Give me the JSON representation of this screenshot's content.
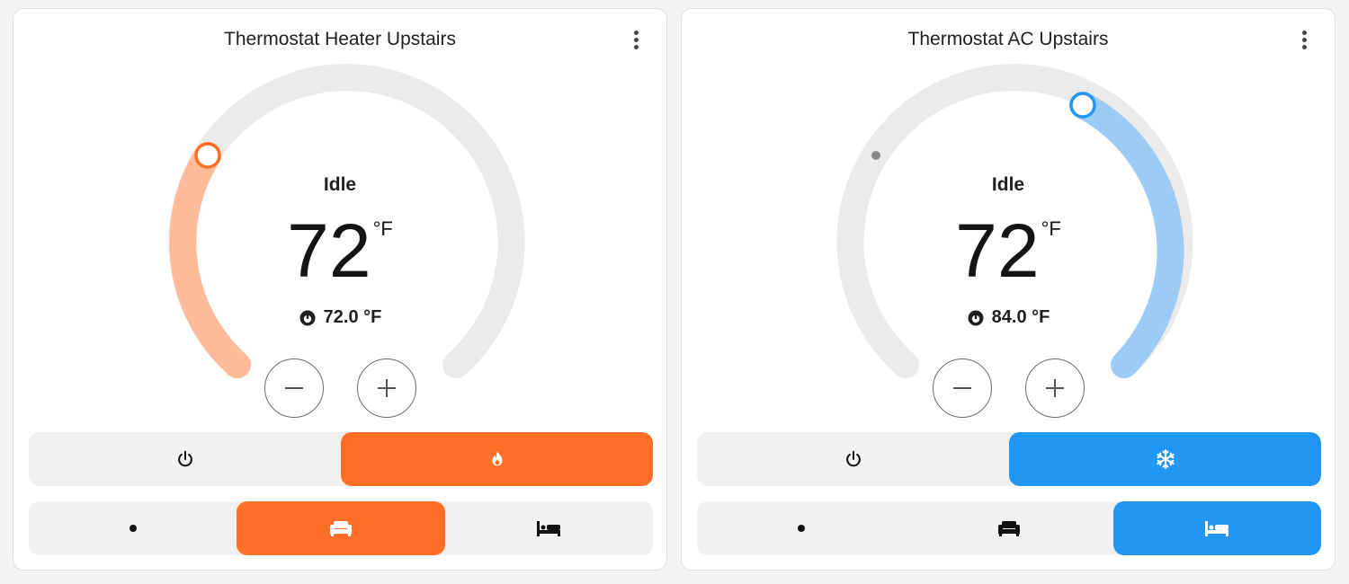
{
  "cards": [
    {
      "title": "Thermostat Heater Upstairs",
      "hvac_action": "Idle",
      "target_temperature": "72",
      "unit": "°F",
      "current_temperature": "72.0 °F",
      "mode": "heat",
      "accent_color": "#ff7026",
      "arc_fill_color": "#ffbb9a",
      "range": [
        45,
        95
      ],
      "target_value": 72,
      "current_value": 72.0,
      "modes": [
        "off",
        "heat"
      ],
      "selected_mode": "heat",
      "presets": [
        "none",
        "home",
        "sleep"
      ],
      "selected_preset": "home",
      "icons": {
        "menu": "dots-vertical-icon",
        "current": "thermometer-icon",
        "minus": "minus-icon",
        "plus": "plus-icon",
        "off": "power-icon",
        "mode": "fire-icon",
        "preset_none": "dot-icon",
        "preset_home": "sofa-icon",
        "preset_sleep": "bed-icon"
      }
    },
    {
      "title": "Thermostat AC Upstairs",
      "hvac_action": "Idle",
      "target_temperature": "72",
      "unit": "°F",
      "current_temperature": "84.0 °F",
      "mode": "cool",
      "accent_color": "#2196f3",
      "arc_fill_color": "#9ccbf7",
      "range": [
        45,
        95
      ],
      "target_value": 72,
      "current_value": 84.0,
      "modes": [
        "off",
        "cool"
      ],
      "selected_mode": "cool",
      "presets": [
        "none",
        "home",
        "sleep"
      ],
      "selected_preset": "sleep",
      "icons": {
        "menu": "dots-vertical-icon",
        "current": "thermometer-icon",
        "minus": "minus-icon",
        "plus": "plus-icon",
        "off": "power-icon",
        "mode": "snowflake-icon",
        "preset_none": "dot-icon",
        "preset_home": "sofa-icon",
        "preset_sleep": "bed-icon"
      }
    }
  ]
}
